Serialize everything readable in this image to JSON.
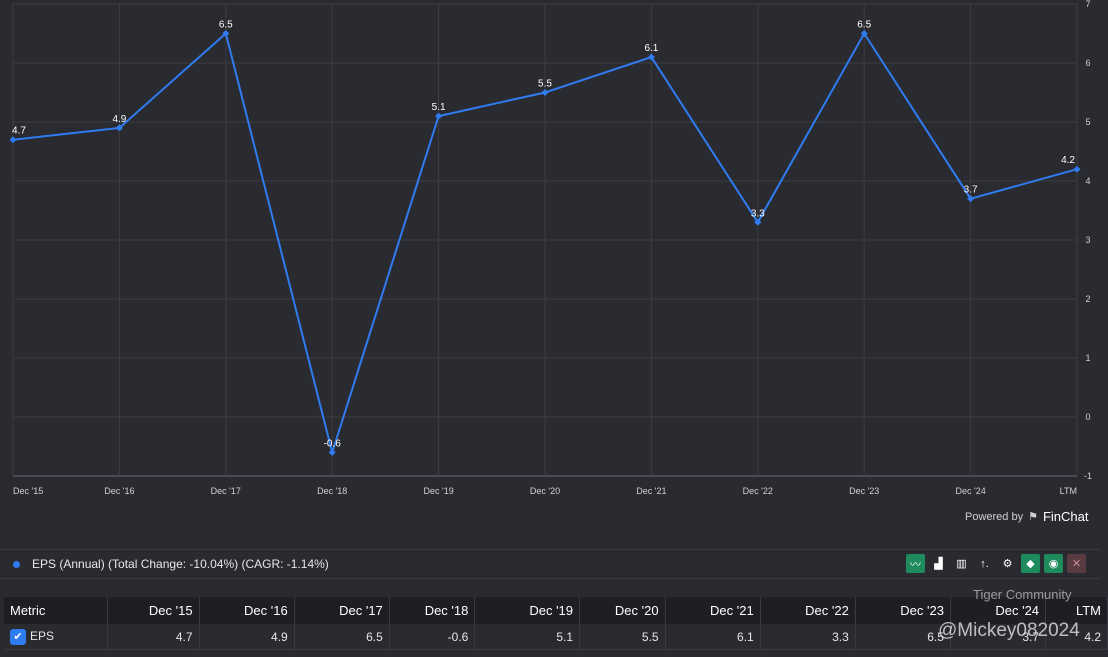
{
  "chart_data": {
    "type": "line",
    "title": "",
    "categories": [
      "Dec '15",
      "Dec '16",
      "Dec '17",
      "Dec '18",
      "Dec '19",
      "Dec '20",
      "Dec '21",
      "Dec '22",
      "Dec '23",
      "Dec '24",
      "LTM"
    ],
    "series": [
      {
        "name": "EPS (Annual)",
        "values": [
          4.7,
          4.9,
          6.5,
          -0.6,
          5.1,
          5.5,
          6.1,
          3.3,
          6.5,
          3.7,
          4.2
        ],
        "color": "#2f7bf0"
      }
    ],
    "ylim": [
      -1,
      7
    ],
    "yticks": [
      -1,
      0,
      1,
      2,
      3,
      4,
      5,
      6,
      7
    ],
    "grid": true,
    "legend": "bottom-left"
  },
  "powered_by": "Powered by",
  "brand": "FinChat",
  "legend_text": "EPS (Annual) (Total Change: -10.04%) (CAGR: -1.14%)",
  "tools": [
    "line-chart-icon",
    "bar-chart-icon",
    "stacked-bar-icon",
    "sort-icon",
    "gear-icon",
    "tag-icon",
    "eye-icon",
    "close-icon"
  ],
  "table": {
    "headers": [
      "Metric",
      "Dec '15",
      "Dec '16",
      "Dec '17",
      "Dec '18",
      "Dec '19",
      "Dec '20",
      "Dec '21",
      "Dec '22",
      "Dec '23",
      "Dec '24",
      "LTM"
    ],
    "row": [
      "EPS",
      "4.7",
      "4.9",
      "6.5",
      "-0.6",
      "5.1",
      "5.5",
      "6.1",
      "3.3",
      "6.5",
      "3.7",
      "4.2"
    ]
  },
  "watermark": {
    "brand": "Tiger Community",
    "user": "@Mickey082024"
  }
}
